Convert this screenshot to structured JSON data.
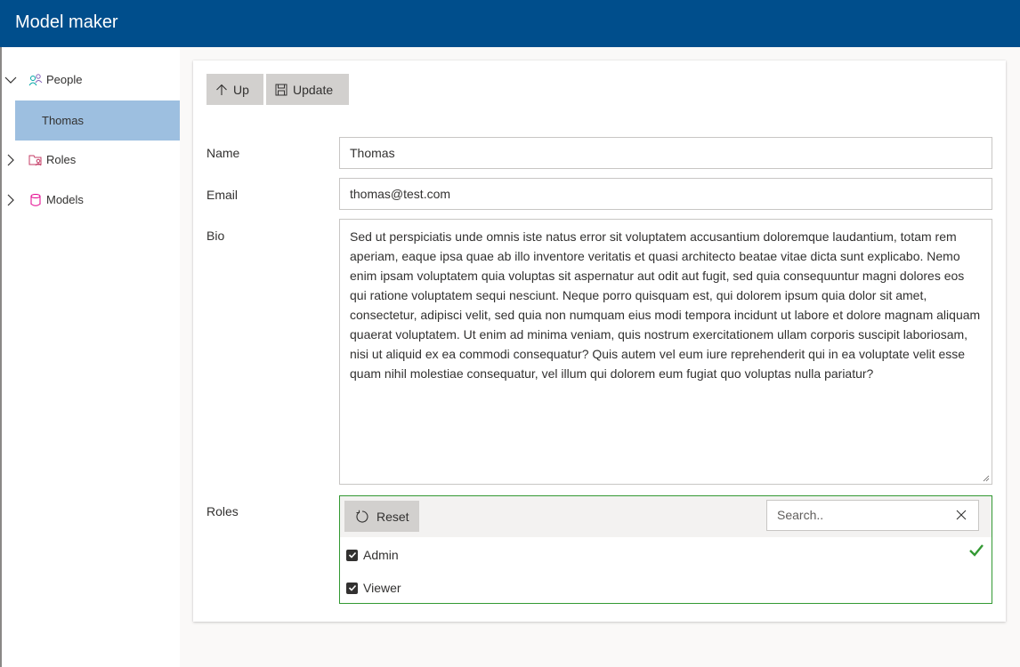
{
  "app": {
    "title": "Model maker"
  },
  "sidebar": {
    "items": [
      {
        "label": "People",
        "icon": "people-icon",
        "expanded": true
      },
      {
        "label": "Thomas",
        "selected": true
      },
      {
        "label": "Roles",
        "icon": "roles-icon",
        "expanded": false
      },
      {
        "label": "Models",
        "icon": "database-icon",
        "expanded": false
      }
    ]
  },
  "toolbar": {
    "up_label": "Up",
    "update_label": "Update"
  },
  "form": {
    "name_label": "Name",
    "name_value": "Thomas",
    "email_label": "Email",
    "email_value": "thomas@test.com",
    "bio_label": "Bio",
    "bio_value": "Sed ut perspiciatis unde omnis iste natus error sit voluptatem accusantium doloremque laudantium, totam rem aperiam, eaque ipsa quae ab illo inventore veritatis et quasi architecto beatae vitae dicta sunt explicabo. Nemo enim ipsam voluptatem quia voluptas sit aspernatur aut odit aut fugit, sed quia consequuntur magni dolores eos qui ratione voluptatem sequi nesciunt. Neque porro quisquam est, qui dolorem ipsum quia dolor sit amet, consectetur, adipisci velit, sed quia non numquam eius modi tempora incidunt ut labore et dolore magnam aliquam quaerat voluptatem. Ut enim ad minima veniam, quis nostrum exercitationem ullam corporis suscipit laboriosam, nisi ut aliquid ex ea commodi consequatur? Quis autem vel eum iure reprehenderit qui in ea voluptate velit esse quam nihil molestiae consequatur, vel illum qui dolorem eum fugiat quo voluptas nulla pariatur?",
    "roles_label": "Roles"
  },
  "roles": {
    "reset_label": "Reset",
    "search_placeholder": "Search..",
    "items": [
      {
        "label": "Admin",
        "checked": true
      },
      {
        "label": "Viewer",
        "checked": true
      }
    ]
  },
  "colors": {
    "header": "#004e8c",
    "selected": "#9dbfe0",
    "valid": "#339933"
  }
}
